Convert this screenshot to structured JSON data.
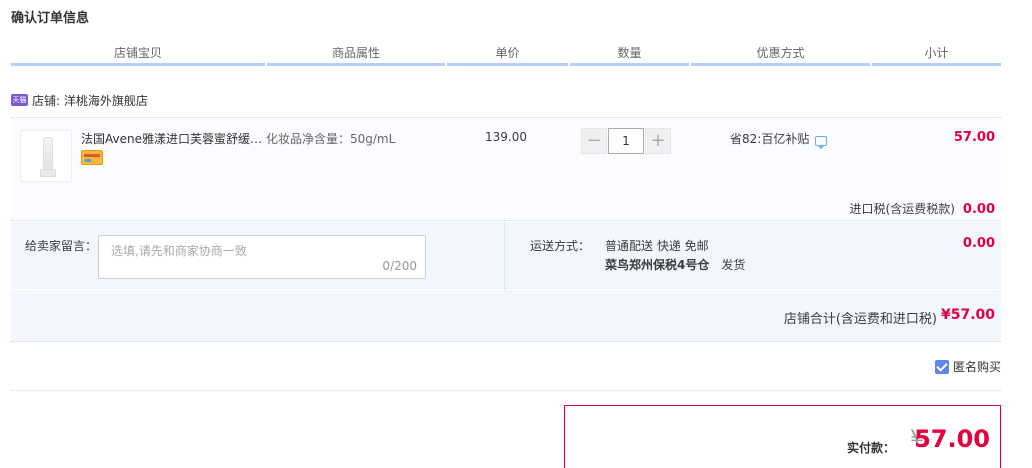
{
  "page": {
    "title": "确认订单信息"
  },
  "columns": [
    "店铺宝贝",
    "商品属性",
    "单价",
    "数量",
    "优惠方式",
    "小计"
  ],
  "shop": {
    "badge": "天猫",
    "label": "店铺: 洋桃海外旗舰店"
  },
  "item": {
    "name": "法国Avene雅漾进口芙蓉蜜舒缓…",
    "attribute": "化妆品净含量：50g/mL",
    "price": "139.00",
    "quantity": "1",
    "minus": "−",
    "plus": "+",
    "promotion": "省82:百亿补贴",
    "subtotal": "57.00",
    "tax_label": "进口税(含运费税款)",
    "tax_value": "0.00"
  },
  "message": {
    "label": "给卖家留言：",
    "placeholder": "选填,请先和商家协商一致",
    "counter": "0/200"
  },
  "shipping": {
    "label": "运送方式：",
    "method": "普通配送 快递 免邮",
    "warehouse": "菜鸟郑州保税4号仓",
    "dispatch": "发货",
    "fee": "0.00"
  },
  "shop_total": {
    "label": "店铺合计(含运费和进口税)",
    "value": "¥57.00"
  },
  "anonymous": {
    "label": "匿名购买",
    "checked": true
  },
  "payment": {
    "label": "实付款：",
    "currency": "¥",
    "value": "57.00"
  },
  "colors": {
    "accent_red": "#e4003e",
    "header_line": "#b2d1ff",
    "checkbox": "#5c86f0"
  }
}
